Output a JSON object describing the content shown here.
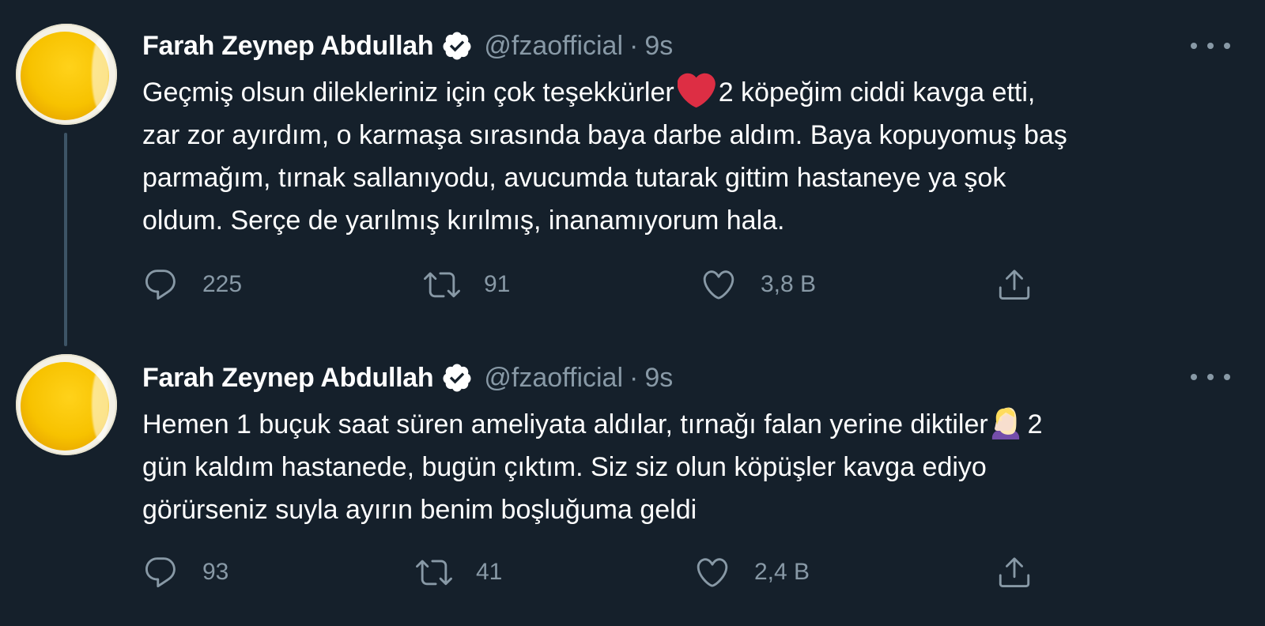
{
  "colors": {
    "background": "#15202b",
    "text_primary": "#ffffff",
    "text_secondary": "#8899a6",
    "thread_line": "#3d5466",
    "heart_emoji": "#e0245e",
    "avatar_yellow": "#f7c200"
  },
  "tweets": [
    {
      "author": {
        "display_name": "Farah Zeynep Abdullah",
        "handle": "@fzaofficial",
        "verified": true,
        "avatar": "yellow-balloon-avatar"
      },
      "separator": "·",
      "time": "9s",
      "text_lines": [
        "Geçmiş olsun dilekleriniz için çok teşekkürler",
        "2 köpeğim ciddi kavga etti,",
        "zar zor ayırdım, o karmaşa sırasında baya darbe aldım. Baya kopuyomuş baş",
        "parmağım, tırnak sallanıyodu, avucumda tutarak gittim hastaneye ya şok",
        "oldum. Serçe de yarılmış kırılmış, inanamıyorum hala."
      ],
      "inline_emoji": "red-heart-emoji",
      "stats": {
        "replies": "225",
        "retweets": "91",
        "likes": "3,8 B"
      }
    },
    {
      "author": {
        "display_name": "Farah Zeynep Abdullah",
        "handle": "@fzaofficial",
        "verified": true,
        "avatar": "yellow-balloon-avatar"
      },
      "separator": "·",
      "time": "9s",
      "text_lines": [
        "Hemen 1 buçuk saat süren ameliyata aldılar, tırnağı falan yerine diktiler",
        "2",
        "gün kaldım hastanede, bugün çıktım. Siz siz olun köpüşler kavga ediyo",
        "görürseniz suyla ayırın benim boşluğuma geldi"
      ],
      "inline_emoji": "woman-facepalming-emoji",
      "stats": {
        "replies": "93",
        "retweets": "41",
        "likes": "2,4 B"
      }
    }
  ],
  "icons": {
    "reply": "reply-icon",
    "retweet": "retweet-icon",
    "like": "like-icon",
    "share": "share-icon",
    "more": "more-options-icon",
    "verified": "verified-badge-icon"
  }
}
